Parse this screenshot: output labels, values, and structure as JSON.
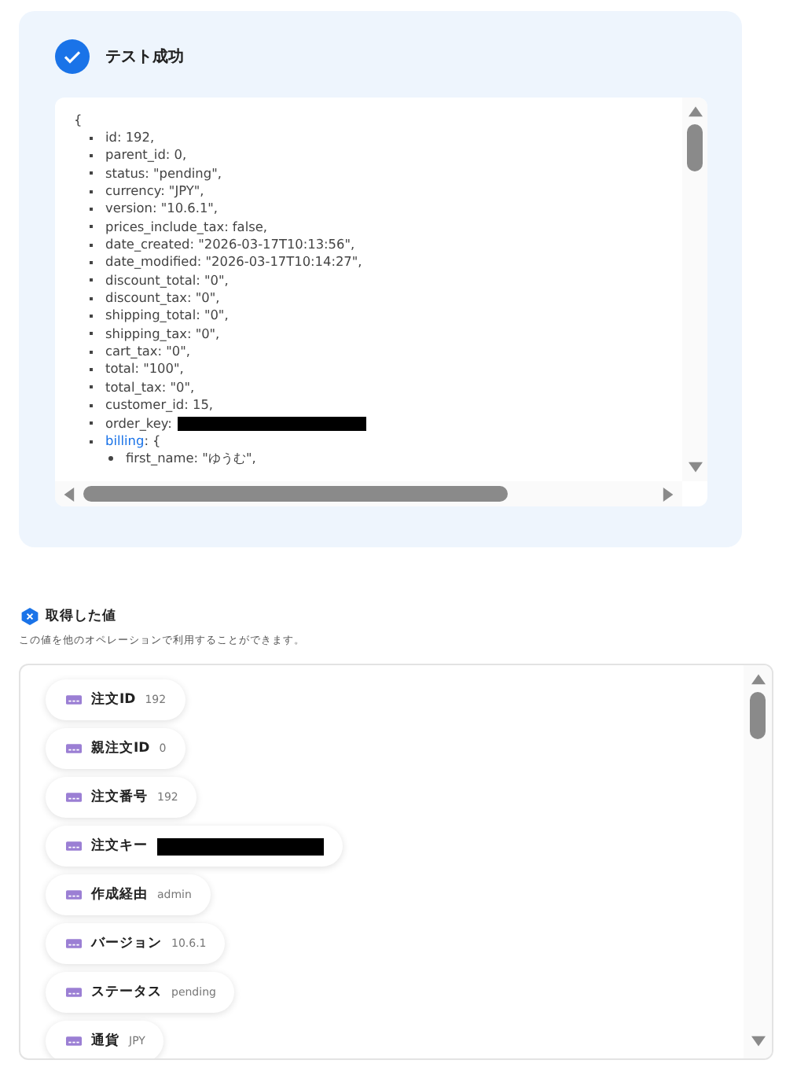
{
  "result": {
    "title": "テスト成功",
    "success": true,
    "open_brace": "{",
    "lines": [
      {
        "kind": "plain",
        "key": "id:",
        "value": "192,"
      },
      {
        "kind": "plain",
        "key": "parent_id:",
        "value": "0,"
      },
      {
        "kind": "plain",
        "key": "status:",
        "value": "\"pending\","
      },
      {
        "kind": "plain",
        "key": "currency:",
        "value": "\"JPY\","
      },
      {
        "kind": "plain",
        "key": "version:",
        "value": "\"10.6.1\","
      },
      {
        "kind": "plain",
        "key": "prices_include_tax:",
        "value": "false,"
      },
      {
        "kind": "plain",
        "key": "date_created:",
        "value": "\"2026-03-17T10:13:56\","
      },
      {
        "kind": "plain",
        "key": "date_modified:",
        "value": "\"2026-03-17T10:14:27\","
      },
      {
        "kind": "plain",
        "key": "discount_total:",
        "value": "\"0\","
      },
      {
        "kind": "plain",
        "key": "discount_tax:",
        "value": "\"0\","
      },
      {
        "kind": "plain",
        "key": "shipping_total:",
        "value": "\"0\","
      },
      {
        "kind": "plain",
        "key": "shipping_tax:",
        "value": "\"0\","
      },
      {
        "kind": "plain",
        "key": "cart_tax:",
        "value": "\"0\","
      },
      {
        "kind": "plain",
        "key": "total:",
        "value": "\"100\","
      },
      {
        "kind": "plain",
        "key": "total_tax:",
        "value": "\"0\","
      },
      {
        "kind": "plain",
        "key": "customer_id:",
        "value": "15,"
      },
      {
        "kind": "redacted",
        "key": "order_key:"
      },
      {
        "kind": "object",
        "key": "billing",
        "value": ": {",
        "children": [
          {
            "kind": "plain",
            "key": "first_name:",
            "value": "\"ゆうむ\","
          }
        ]
      }
    ]
  },
  "values": {
    "title": "取得した値",
    "description": "この値を他のオペレーションで利用することができます。",
    "items": [
      {
        "label": "注文ID",
        "kind": "plain",
        "value": "192"
      },
      {
        "label": "親注文ID",
        "kind": "plain",
        "value": "0"
      },
      {
        "label": "注文番号",
        "kind": "plain",
        "value": "192"
      },
      {
        "label": "注文キー",
        "kind": "redacted"
      },
      {
        "label": "作成経由",
        "kind": "plain",
        "value": "admin"
      },
      {
        "label": "バージョン",
        "kind": "plain",
        "value": "10.6.1"
      },
      {
        "label": "ステータス",
        "kind": "plain",
        "value": "pending"
      },
      {
        "label": "通貨",
        "kind": "plain",
        "value": "JPY"
      }
    ]
  }
}
